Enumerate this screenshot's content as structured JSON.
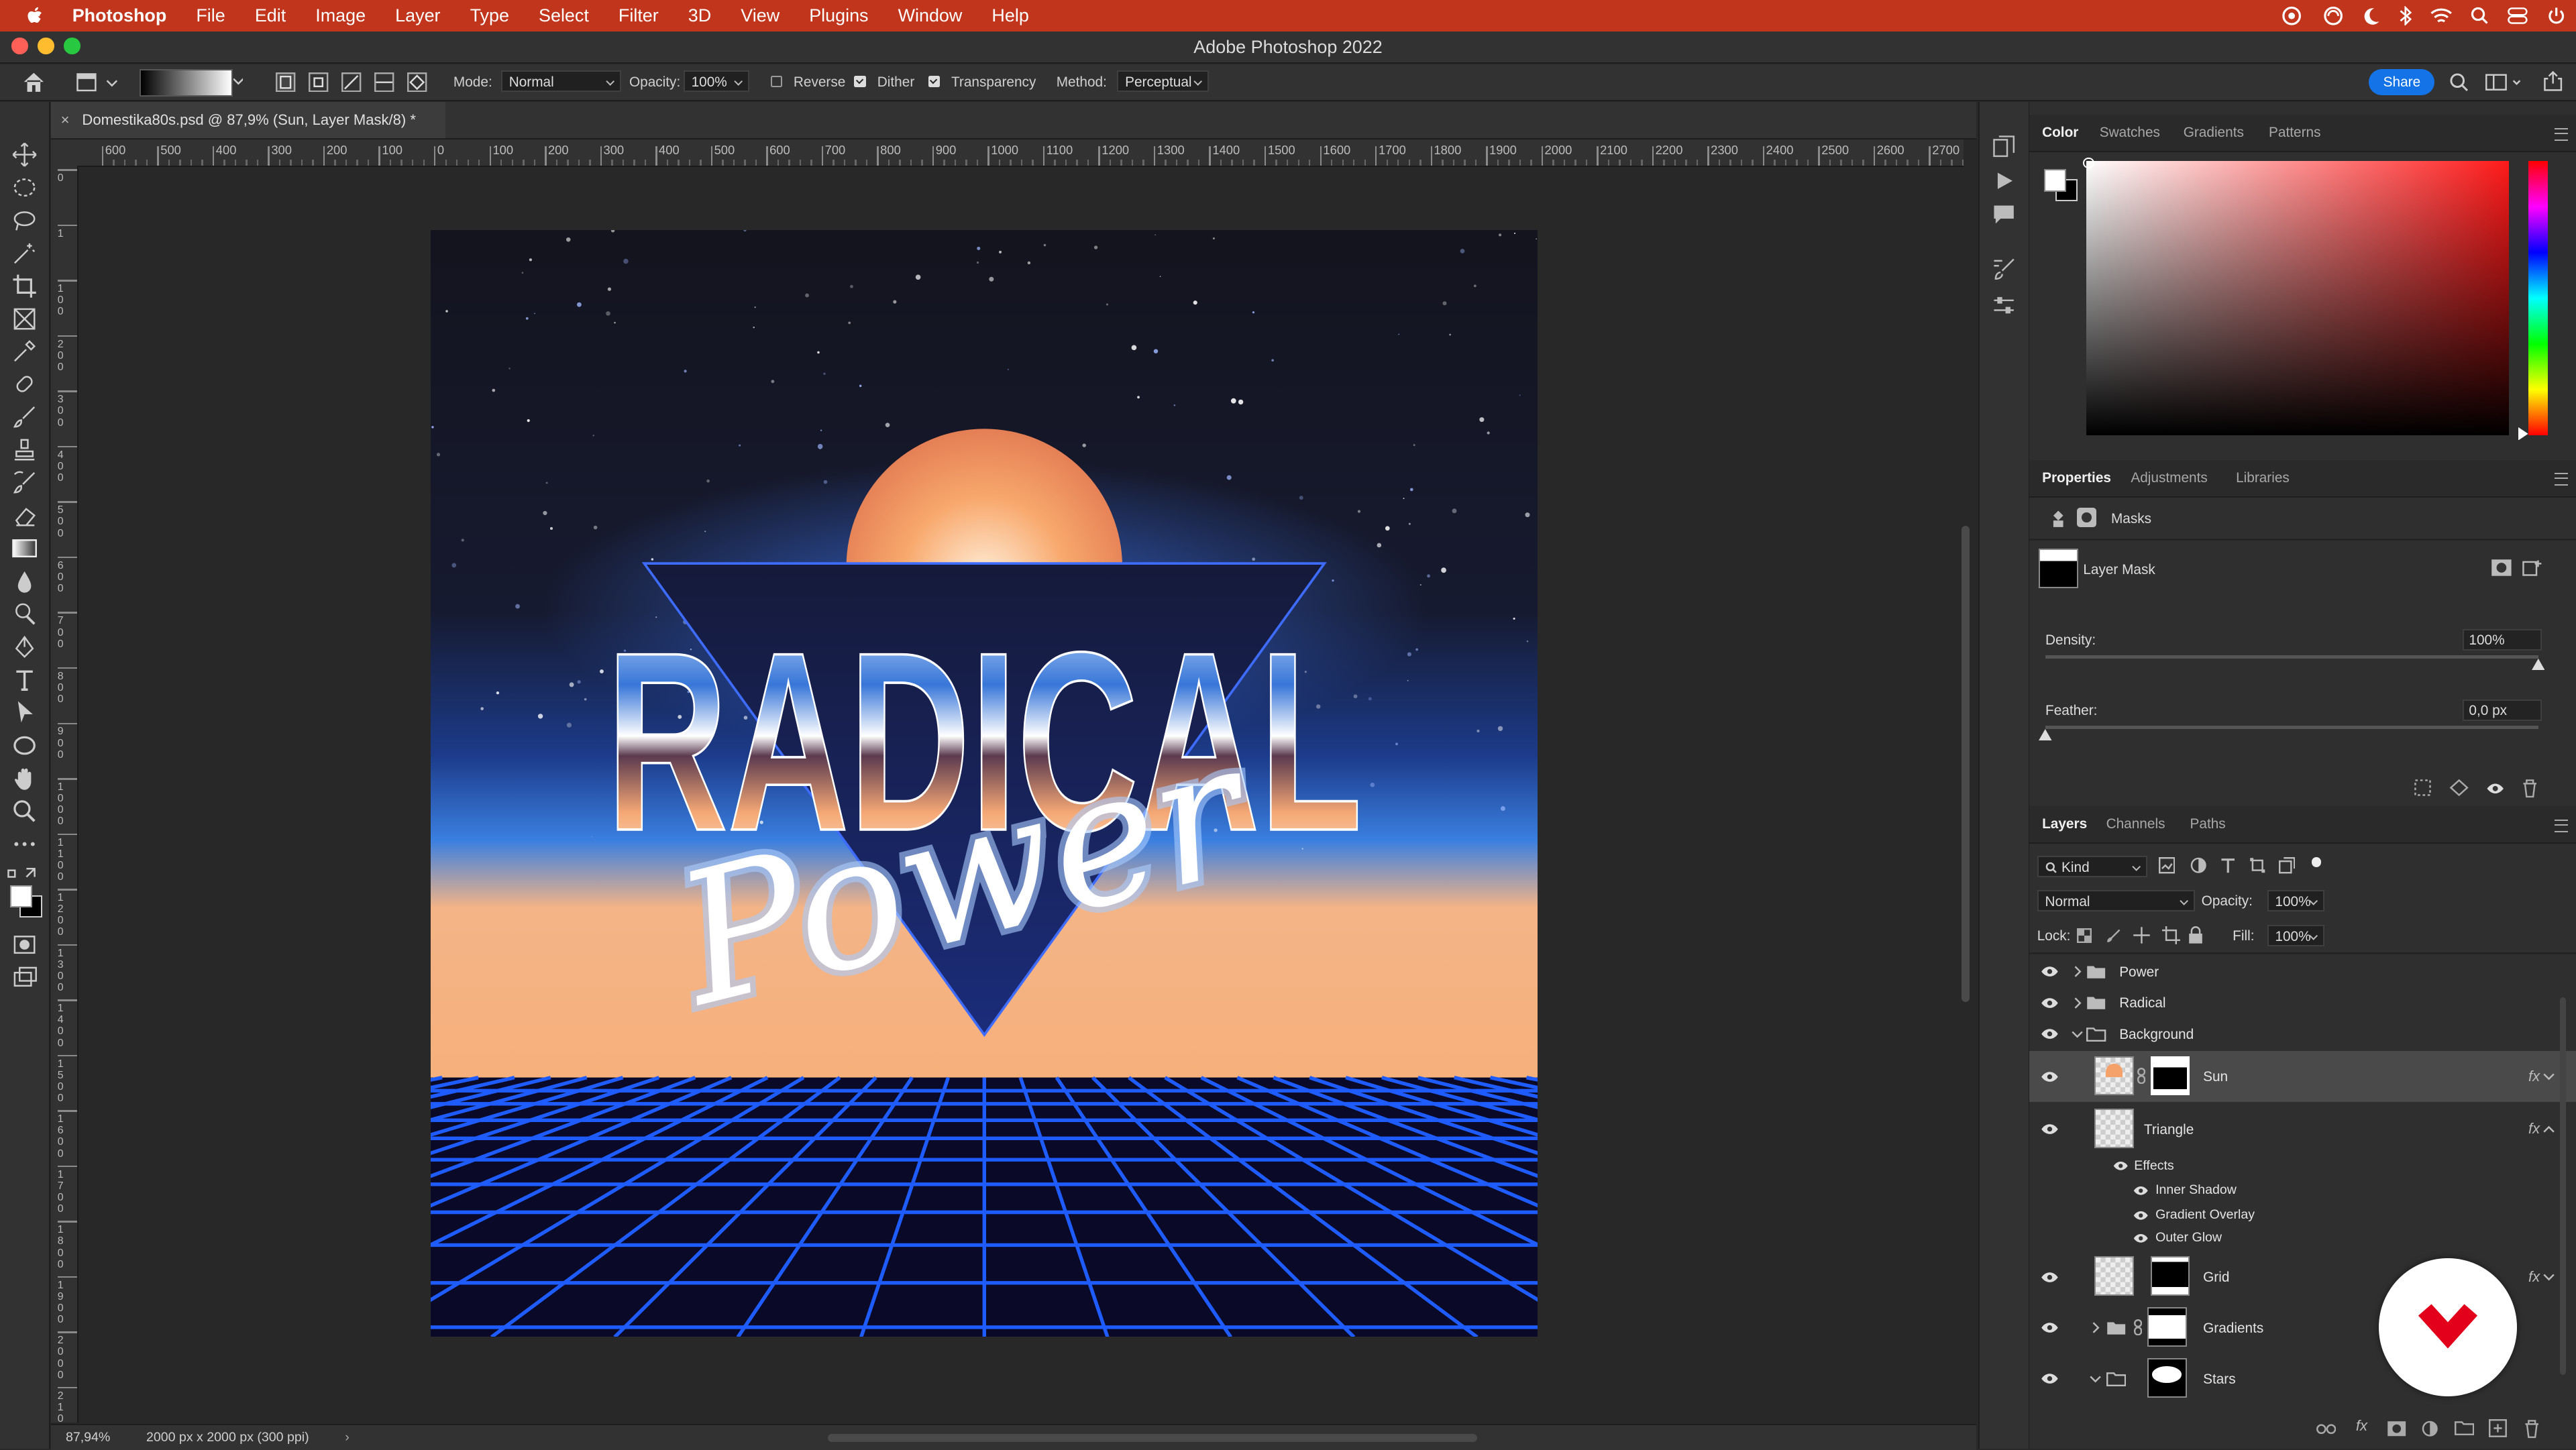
{
  "menubar": {
    "app": "Photoshop",
    "items": [
      "File",
      "Edit",
      "Image",
      "Layer",
      "Type",
      "Select",
      "Filter",
      "3D",
      "View",
      "Plugins",
      "Window",
      "Help"
    ]
  },
  "window": {
    "title": "Adobe Photoshop 2022"
  },
  "options": {
    "mode_label": "Mode:",
    "mode_value": "Normal",
    "opacity_label": "Opacity:",
    "opacity_value": "100%",
    "reverse": "Reverse",
    "dither": "Dither",
    "transparency": "Transparency",
    "method_label": "Method:",
    "method_value": "Perceptual",
    "share": "Share"
  },
  "document": {
    "tab_title": "Domestika80s.psd @ 87,9% (Sun, Layer Mask/8) *",
    "zoom": "87,94%",
    "doc_info": "2000 px x 2000 px (300 ppi)"
  },
  "ruler": {
    "h_labels": [
      "600",
      "500",
      "400",
      "300",
      "200",
      "100",
      "0",
      "100",
      "200",
      "300",
      "400",
      "500",
      "600",
      "700",
      "800",
      "900",
      "1000",
      "1100",
      "1200",
      "1300",
      "1400",
      "1500",
      "1600",
      "1700",
      "1800",
      "1900",
      "2000",
      "2100",
      "2200",
      "2300",
      "2400",
      "2500",
      "2600",
      "2700"
    ],
    "v_labels": [
      "0",
      "1",
      "1\n0\n0",
      "2\n0\n0",
      "3\n0\n0",
      "4\n0\n0",
      "5\n0\n0",
      "6\n0\n0",
      "7\n0\n0",
      "8\n0\n0",
      "9\n0\n0",
      "1\n0\n0\n0",
      "1\n1\n0\n0",
      "1\n2\n0\n0",
      "1\n3\n0\n0",
      "1\n4\n0\n0",
      "1\n5\n0\n0",
      "1\n6\n0\n0",
      "1\n7\n0\n0",
      "1\n8\n0\n0",
      "1\n9\n0\n0",
      "2\n0\n0\n0",
      "2\n1\n0\n0"
    ]
  },
  "artwork": {
    "word1": "RADICAL",
    "word2": "Power"
  },
  "color_panel": {
    "tabs": [
      "Color",
      "Swatches",
      "Gradients",
      "Patterns"
    ],
    "active": "Color",
    "hue": "#ff1a1a"
  },
  "properties_panel": {
    "tabs": [
      "Properties",
      "Adjustments",
      "Libraries"
    ],
    "masks": "Masks",
    "layer_mask": "Layer Mask",
    "density_label": "Density:",
    "density_value": "100%",
    "density": 1.0,
    "feather_label": "Feather:",
    "feather_value": "0,0 px",
    "feather": 0.0
  },
  "layers_panel": {
    "tabs": [
      "Layers",
      "Channels",
      "Paths"
    ],
    "kind": "Kind",
    "blend": "Normal",
    "opacity_label": "Opacity:",
    "opacity_value": "100%",
    "lock_label": "Lock:",
    "fill_label": "Fill:",
    "fill_value": "100%",
    "layers": {
      "power": "Power",
      "radical": "Radical",
      "background": "Background",
      "sun": "Sun",
      "triangle": "Triangle",
      "effects": "Effects",
      "inner_shadow": "Inner Shadow",
      "gradient_overlay": "Gradient Overlay",
      "outer_glow": "Outer Glow",
      "grid": "Grid",
      "gradients": "Gradients",
      "stars": "Stars"
    },
    "fx": "fx"
  },
  "colors": {
    "menubar": "#c1351c",
    "accent": "#1473e6",
    "badge": "#e2001a"
  }
}
